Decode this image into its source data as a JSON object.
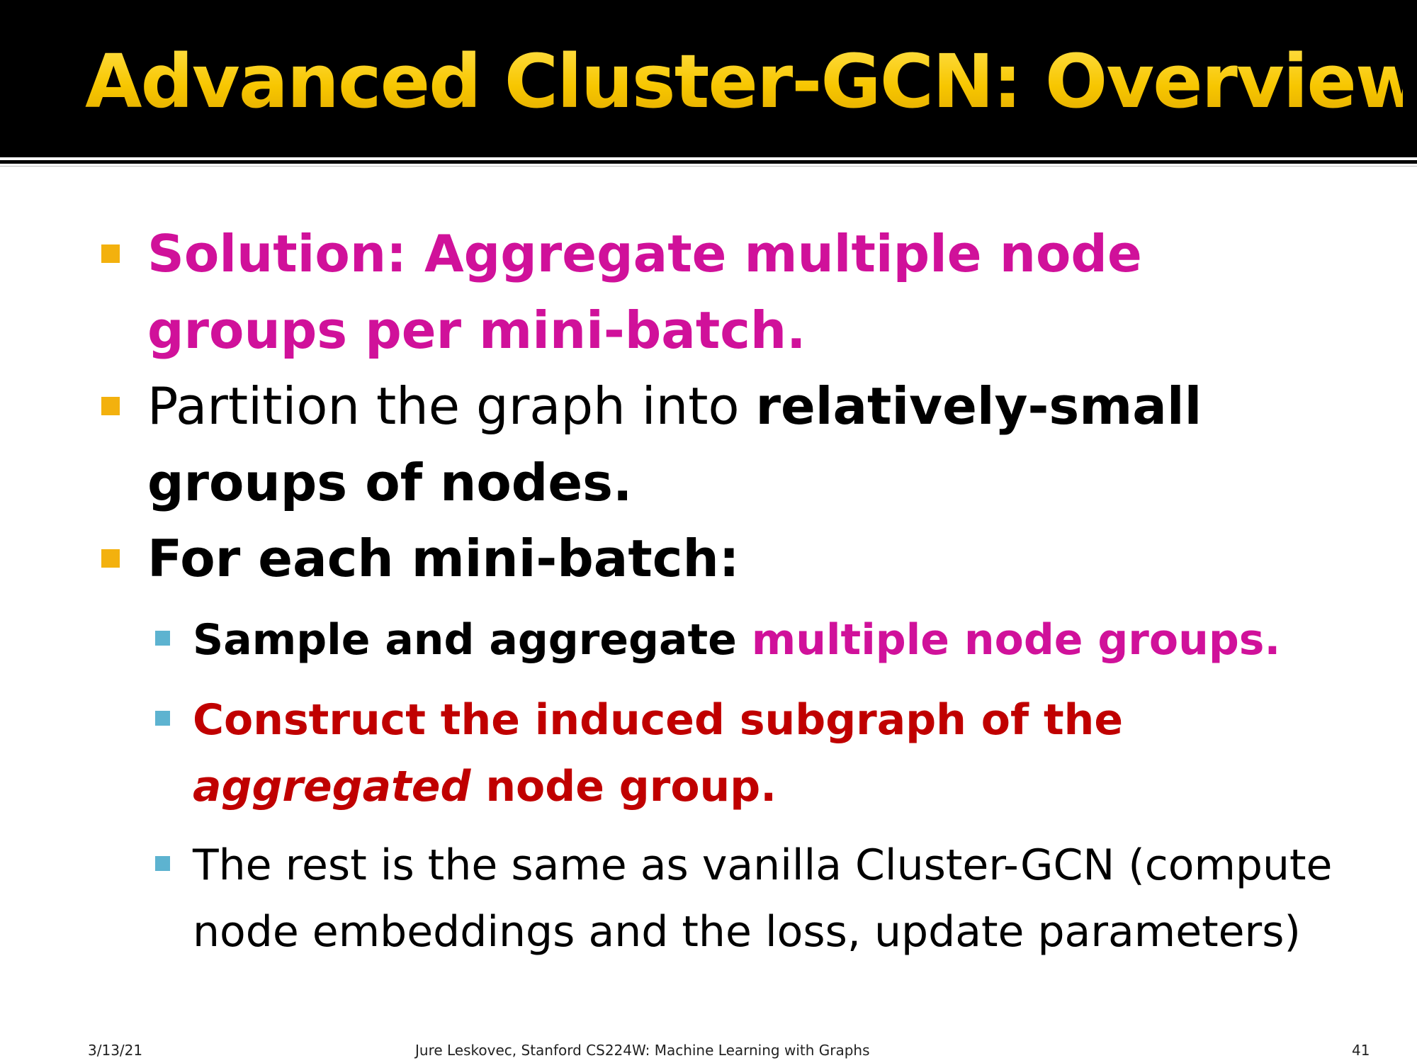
{
  "slide": {
    "title": "Advanced Cluster-GCN: Overview",
    "bullets": [
      {
        "level": 1,
        "runs": [
          {
            "text": "Solution: Aggregate multiple node groups per mini-batch.",
            "style": "bold",
            "color": "#d0119a"
          }
        ]
      },
      {
        "level": 1,
        "runs": [
          {
            "text": "Partition the graph into ",
            "style": "normal",
            "color": "#000000"
          },
          {
            "text": "relatively-small groups of nodes.",
            "style": "bold",
            "color": "#000000"
          }
        ]
      },
      {
        "level": 1,
        "runs": [
          {
            "text": "For each mini-batch:",
            "style": "bold",
            "color": "#000000"
          }
        ]
      },
      {
        "level": 2,
        "runs": [
          {
            "text": "Sample and aggregate ",
            "style": "bold",
            "color": "#000000"
          },
          {
            "text": "multiple node groups.",
            "style": "bold",
            "color": "#d0119a"
          }
        ]
      },
      {
        "level": 2,
        "runs": [
          {
            "text": "Construct the induced subgraph of the ",
            "style": "bold",
            "color": "#c00000"
          },
          {
            "text": "aggregated",
            "style": "bold-italic",
            "color": "#c00000"
          },
          {
            "text": " node group.",
            "style": "bold",
            "color": "#c00000"
          }
        ]
      },
      {
        "level": 2,
        "runs": [
          {
            "text": "The rest is the same as vanilla Cluster-GCN (compute node embeddings and the loss, update parameters)",
            "style": "normal",
            "color": "#000000"
          }
        ]
      }
    ]
  },
  "footer": {
    "date": "3/13/21",
    "credit": "Jure Leskovec, Stanford CS224W: Machine Learning with Graphs",
    "page_number": "41"
  },
  "colors": {
    "title": "#f7c600",
    "title_background": "#000000",
    "accent_magenta": "#d0119a",
    "accent_red": "#c00000",
    "bullet_level1": "#f3b10e",
    "bullet_level2": "#5db3d0"
  }
}
